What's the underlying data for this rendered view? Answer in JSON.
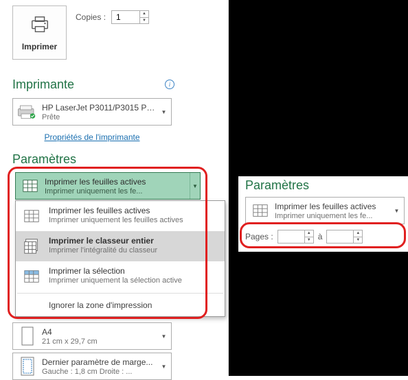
{
  "print_button_label": "Imprimer",
  "copies": {
    "label": "Copies :",
    "value": "1"
  },
  "printer_section": "Imprimante",
  "printer": {
    "name": "HP LaserJet P3011/P3015 PCL6",
    "status": "Prête"
  },
  "printer_properties_link": "Propriétés de l'imprimante",
  "settings_section": "Paramètres",
  "settings_selected": {
    "title": "Imprimer les feuilles actives",
    "subtitle": "Imprimer uniquement les fe..."
  },
  "settings_menu": {
    "items": [
      {
        "title": "Imprimer les feuilles actives",
        "subtitle": "Imprimer uniquement les feuilles actives",
        "hover": false,
        "icon": "sheets-active"
      },
      {
        "title": "Imprimer le classeur entier",
        "subtitle": "Imprimer l'intégralité du classeur",
        "hover": true,
        "icon": "workbook"
      },
      {
        "title": "Imprimer la sélection",
        "subtitle": "Imprimer uniquement la sélection active",
        "hover": false,
        "icon": "selection"
      }
    ],
    "footer": "Ignorer la zone d'impression"
  },
  "paper": {
    "title": "A4",
    "subtitle": "21 cm x 29,7 cm"
  },
  "margins": {
    "title": "Dernier paramètre de marge...",
    "subtitle": "Gauche :   1,8 cm   Droite : ..."
  },
  "right": {
    "heading": "Paramètres",
    "combo": {
      "title": "Imprimer les feuilles actives",
      "subtitle": "Imprimer uniquement les fe..."
    },
    "pages_label": "Pages :",
    "pages_to": "à",
    "from": "",
    "to_val": ""
  }
}
